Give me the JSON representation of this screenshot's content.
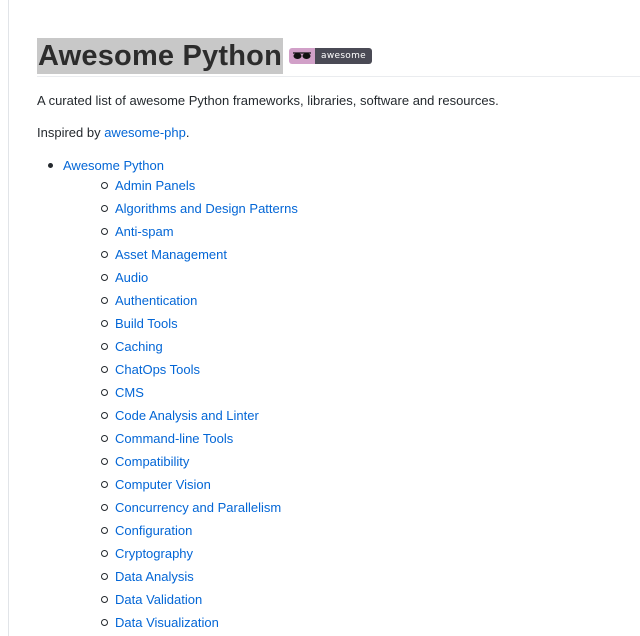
{
  "title": "Awesome Python",
  "badge": {
    "icon": "sunglasses-icon",
    "label": "awesome",
    "left_color": "#d1a0c8",
    "right_color": "#4a4a55"
  },
  "description": "A curated list of awesome Python frameworks, libraries, software and resources.",
  "inspired": {
    "prefix": "Inspired by ",
    "link_text": "awesome-php",
    "suffix": "."
  },
  "toc": {
    "top_item": "Awesome Python",
    "items": [
      "Admin Panels",
      "Algorithms and Design Patterns",
      "Anti-spam",
      "Asset Management",
      "Audio",
      "Authentication",
      "Build Tools",
      "Caching",
      "ChatOps Tools",
      "CMS",
      "Code Analysis and Linter",
      "Command-line Tools",
      "Compatibility",
      "Computer Vision",
      "Concurrency and Parallelism",
      "Configuration",
      "Cryptography",
      "Data Analysis",
      "Data Validation",
      "Data Visualization"
    ]
  },
  "colors": {
    "link": "#0366d6",
    "text": "#24292e",
    "title_highlight": "#c8c8c8"
  }
}
